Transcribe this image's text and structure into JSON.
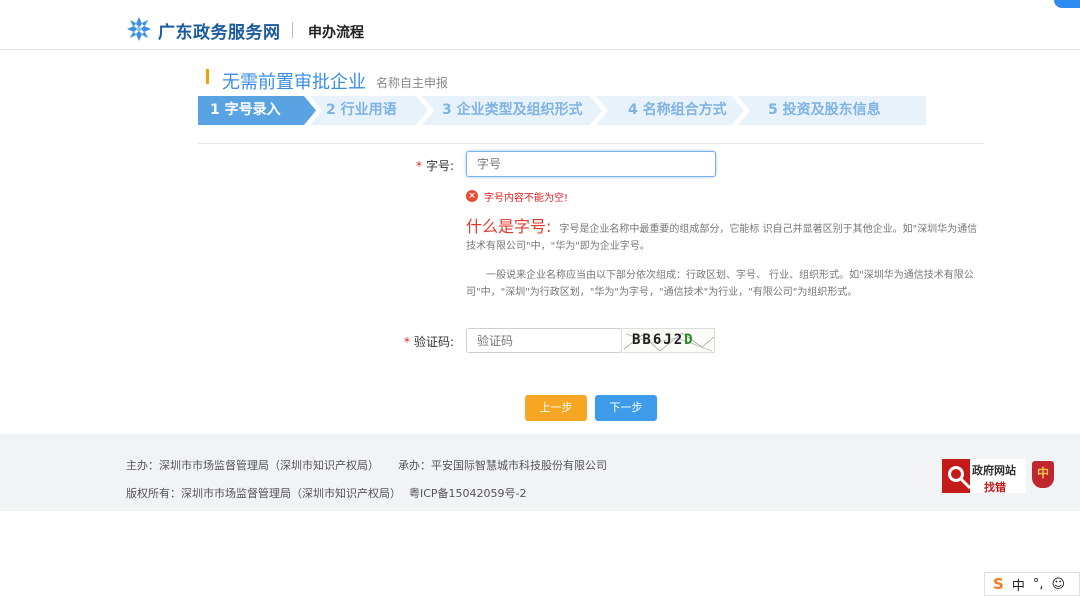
{
  "header": {
    "site_title": "广东政务服务网",
    "nav_link": "申办流程"
  },
  "section": {
    "title": "无需前置审批企业",
    "subtitle": "名称自主申报"
  },
  "steps": [
    {
      "label": "1 字号录入",
      "active": true
    },
    {
      "label": "2 行业用语",
      "active": false
    },
    {
      "label": "3 企业类型及组织形式",
      "active": false
    },
    {
      "label": "4 名称组合方式",
      "active": false
    },
    {
      "label": "5 投资及股东信息",
      "active": false
    }
  ],
  "form": {
    "zihao": {
      "label": "字号:",
      "required_mark": "*",
      "placeholder": "字号",
      "value": "",
      "error": "字号内容不能为空!"
    },
    "help": {
      "heading": "什么是字号:",
      "text1": "字号是企业名称中最重要的组成部分，它能标 识自己并显著区别于其他企业。如\"深圳华为通信技术有限公司\"中，\"华为\"即为企业字号。",
      "text2": "一般说来企业名称应当由以下部分依次组成：行政区划、字号、 行业、组织形式。如\"深圳华为通信技术有限公司\"中，\"深圳\"为行政区划，\"华为\"为字号，\"通信技术\"为行业，\"有限公司\"为组织形式。"
    },
    "captcha": {
      "label": "验证码:",
      "required_mark": "*",
      "placeholder": "验证码",
      "value": "",
      "image_text_a": "BB6J2",
      "image_text_b": "D"
    }
  },
  "buttons": {
    "prev": "上一步",
    "next": "下一步"
  },
  "footer": {
    "host": "主办：深圳市市场监督管理局（深圳市知识产权局）",
    "undertaker": "承办：平安国际智慧城市科技股份有限公司",
    "copyright": "版权所有：深圳市市场监督管理局（深圳市知识产权局）",
    "icp": "粤ICP备15042059号-2",
    "gov_badge_line1": "政府网站",
    "gov_badge_line2": "找错"
  },
  "ime": {
    "mode": "中",
    "punct": "°,"
  },
  "colors": {
    "accent": "#3a8ee6",
    "step_active": "#5aa3e3",
    "step_inactive": "#e8f2fb",
    "error": "#e02020",
    "prev_button": "#f5a623",
    "next_button": "#3d9be9"
  },
  "icons": [
    "logo-icon",
    "error-icon",
    "gov-site-icon",
    "emblem-icon",
    "sogou-icon",
    "emoji-icon"
  ]
}
